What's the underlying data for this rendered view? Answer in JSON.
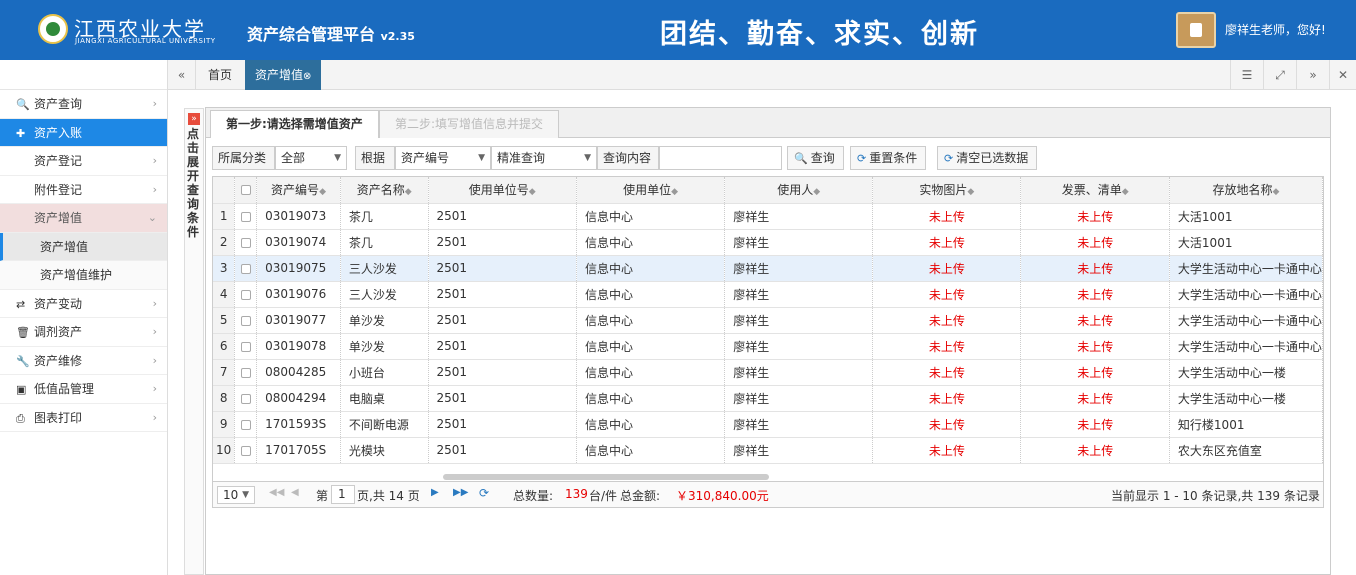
{
  "header": {
    "school_cn": "江西农业大学",
    "school_en": "JIANGXI AGRICULTURAL UNIVERSITY",
    "app_title": "资产综合管理平台",
    "version": "v2.35",
    "slogan": "团结、勤奋、求实、创新",
    "greeting": "廖祥生老师，您好!"
  },
  "sidebar": {
    "items": [
      {
        "label": "资产查询",
        "icon": "search-icon"
      },
      {
        "label": "资产入账",
        "icon": "plus-icon"
      },
      {
        "label": "资产登记"
      },
      {
        "label": "附件登记"
      },
      {
        "label": "资产增值"
      },
      {
        "label": "资产增值"
      },
      {
        "label": "资产增值维护"
      },
      {
        "label": "资产变动",
        "icon": "shuffle-icon"
      },
      {
        "label": "调剂资产",
        "icon": "trash-icon"
      },
      {
        "label": "资产维修",
        "icon": "wrench-icon"
      },
      {
        "label": "低值品管理",
        "icon": "money-icon"
      },
      {
        "label": "图表打印",
        "icon": "print-icon"
      }
    ]
  },
  "tabs": {
    "home": "首页",
    "active": "资产增值"
  },
  "collapse_label": "点击展开查询条件",
  "steps": {
    "step1": "第一步:请选择需增值资产",
    "step2": "第二步:填写增值信息并提交"
  },
  "filters": {
    "category_label": "所属分类",
    "category_value": "全部",
    "by_label": "根据",
    "field_value": "资产编号",
    "match_value": "精准查询",
    "content_label": "查询内容",
    "content_value": "",
    "search_btn": "查询",
    "reset_btn": "重置条件",
    "clear_btn": "清空已选数据"
  },
  "table": {
    "headers": [
      "资产编号",
      "资产名称",
      "使用单位号",
      "使用单位",
      "使用人",
      "实物图片",
      "发票、清单",
      "存放地名称"
    ],
    "rows": [
      [
        "1",
        "03019073",
        "茶几",
        "2501",
        "信息中心",
        "廖祥生",
        "未上传",
        "未上传",
        "大活1001"
      ],
      [
        "2",
        "03019074",
        "茶几",
        "2501",
        "信息中心",
        "廖祥生",
        "未上传",
        "未上传",
        "大活1001"
      ],
      [
        "3",
        "03019075",
        "三人沙发",
        "2501",
        "信息中心",
        "廖祥生",
        "未上传",
        "未上传",
        "大学生活动中心一卡通中心"
      ],
      [
        "4",
        "03019076",
        "三人沙发",
        "2501",
        "信息中心",
        "廖祥生",
        "未上传",
        "未上传",
        "大学生活动中心一卡通中心"
      ],
      [
        "5",
        "03019077",
        "单沙发",
        "2501",
        "信息中心",
        "廖祥生",
        "未上传",
        "未上传",
        "大学生活动中心一卡通中心"
      ],
      [
        "6",
        "03019078",
        "单沙发",
        "2501",
        "信息中心",
        "廖祥生",
        "未上传",
        "未上传",
        "大学生活动中心一卡通中心"
      ],
      [
        "7",
        "08004285",
        "小班台",
        "2501",
        "信息中心",
        "廖祥生",
        "未上传",
        "未上传",
        "大学生活动中心一楼"
      ],
      [
        "8",
        "08004294",
        "电脑桌",
        "2501",
        "信息中心",
        "廖祥生",
        "未上传",
        "未上传",
        "大学生活动中心一楼"
      ],
      [
        "9",
        "1701593S",
        "不间断电源",
        "2501",
        "信息中心",
        "廖祥生",
        "未上传",
        "未上传",
        "知行楼1001"
      ],
      [
        "10",
        "1701705S",
        "光模块",
        "2501",
        "信息中心",
        "廖祥生",
        "未上传",
        "未上传",
        "农大东区充值室"
      ]
    ]
  },
  "pager": {
    "page_size": "10",
    "page_label_pre": "第",
    "page_num": "1",
    "page_label_post": "页,共 14 页",
    "total_count_label": "总数量:",
    "total_count": "139",
    "total_count_unit": "台/件",
    "total_amount_label": "总金额:",
    "total_amount": "￥310,840.00元",
    "display_info": "当前显示 1 - 10 条记录,共 139 条记录"
  },
  "colors": {
    "header_bg": "#1a6bbf",
    "accent": "#1e88e5",
    "warn_red": "#e60000"
  }
}
